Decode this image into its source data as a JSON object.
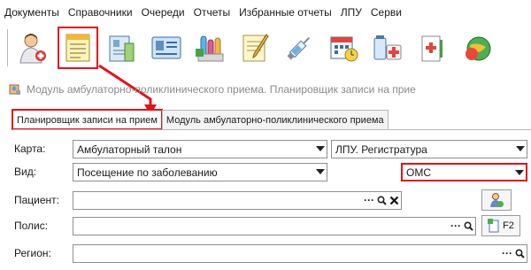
{
  "menu": {
    "items": [
      "Документы",
      "Справочники",
      "Очереди",
      "Отчеты",
      "Избранные отчеты",
      "ЛПУ",
      "Серви"
    ]
  },
  "toolbar": {
    "buttons": [
      {
        "icon": "doctor-icon"
      },
      {
        "icon": "scheduler-icon",
        "highlighted": true
      },
      {
        "icon": "card-icon"
      },
      {
        "icon": "card-list-icon"
      },
      {
        "icon": "lab-icon"
      },
      {
        "icon": "notepad-icon"
      },
      {
        "icon": "syringe-icon"
      },
      {
        "icon": "calendar-icon"
      },
      {
        "icon": "pharmacy-icon"
      },
      {
        "icon": "medical-kit-icon"
      },
      {
        "icon": "globe-icon"
      }
    ]
  },
  "window": {
    "title": "Модуль амбулаторно-поликлинического приема. Планировщик записи на прие"
  },
  "tabs": [
    {
      "label": "Планировщик записи на прием",
      "active": true
    },
    {
      "label": "Модуль амбулаторно-поликлинического приема",
      "active": false
    }
  ],
  "form": {
    "card_label": "Карта:",
    "card_value": "Амбулаторный талон",
    "lpu_value": "ЛПУ. Регистратура",
    "type_label": "Вид:",
    "type_value": "Посещение по заболеванию",
    "payment_value": "ОМС",
    "patient_label": "Пациент:",
    "patient_value": "",
    "policy_label": "Полис:",
    "policy_value": "",
    "region_label": "Регион:",
    "region_value": "",
    "ellipsis": "···",
    "f2_label": "F2"
  },
  "colors": {
    "highlight": "#e3131b",
    "border": "#8f8f8f"
  }
}
